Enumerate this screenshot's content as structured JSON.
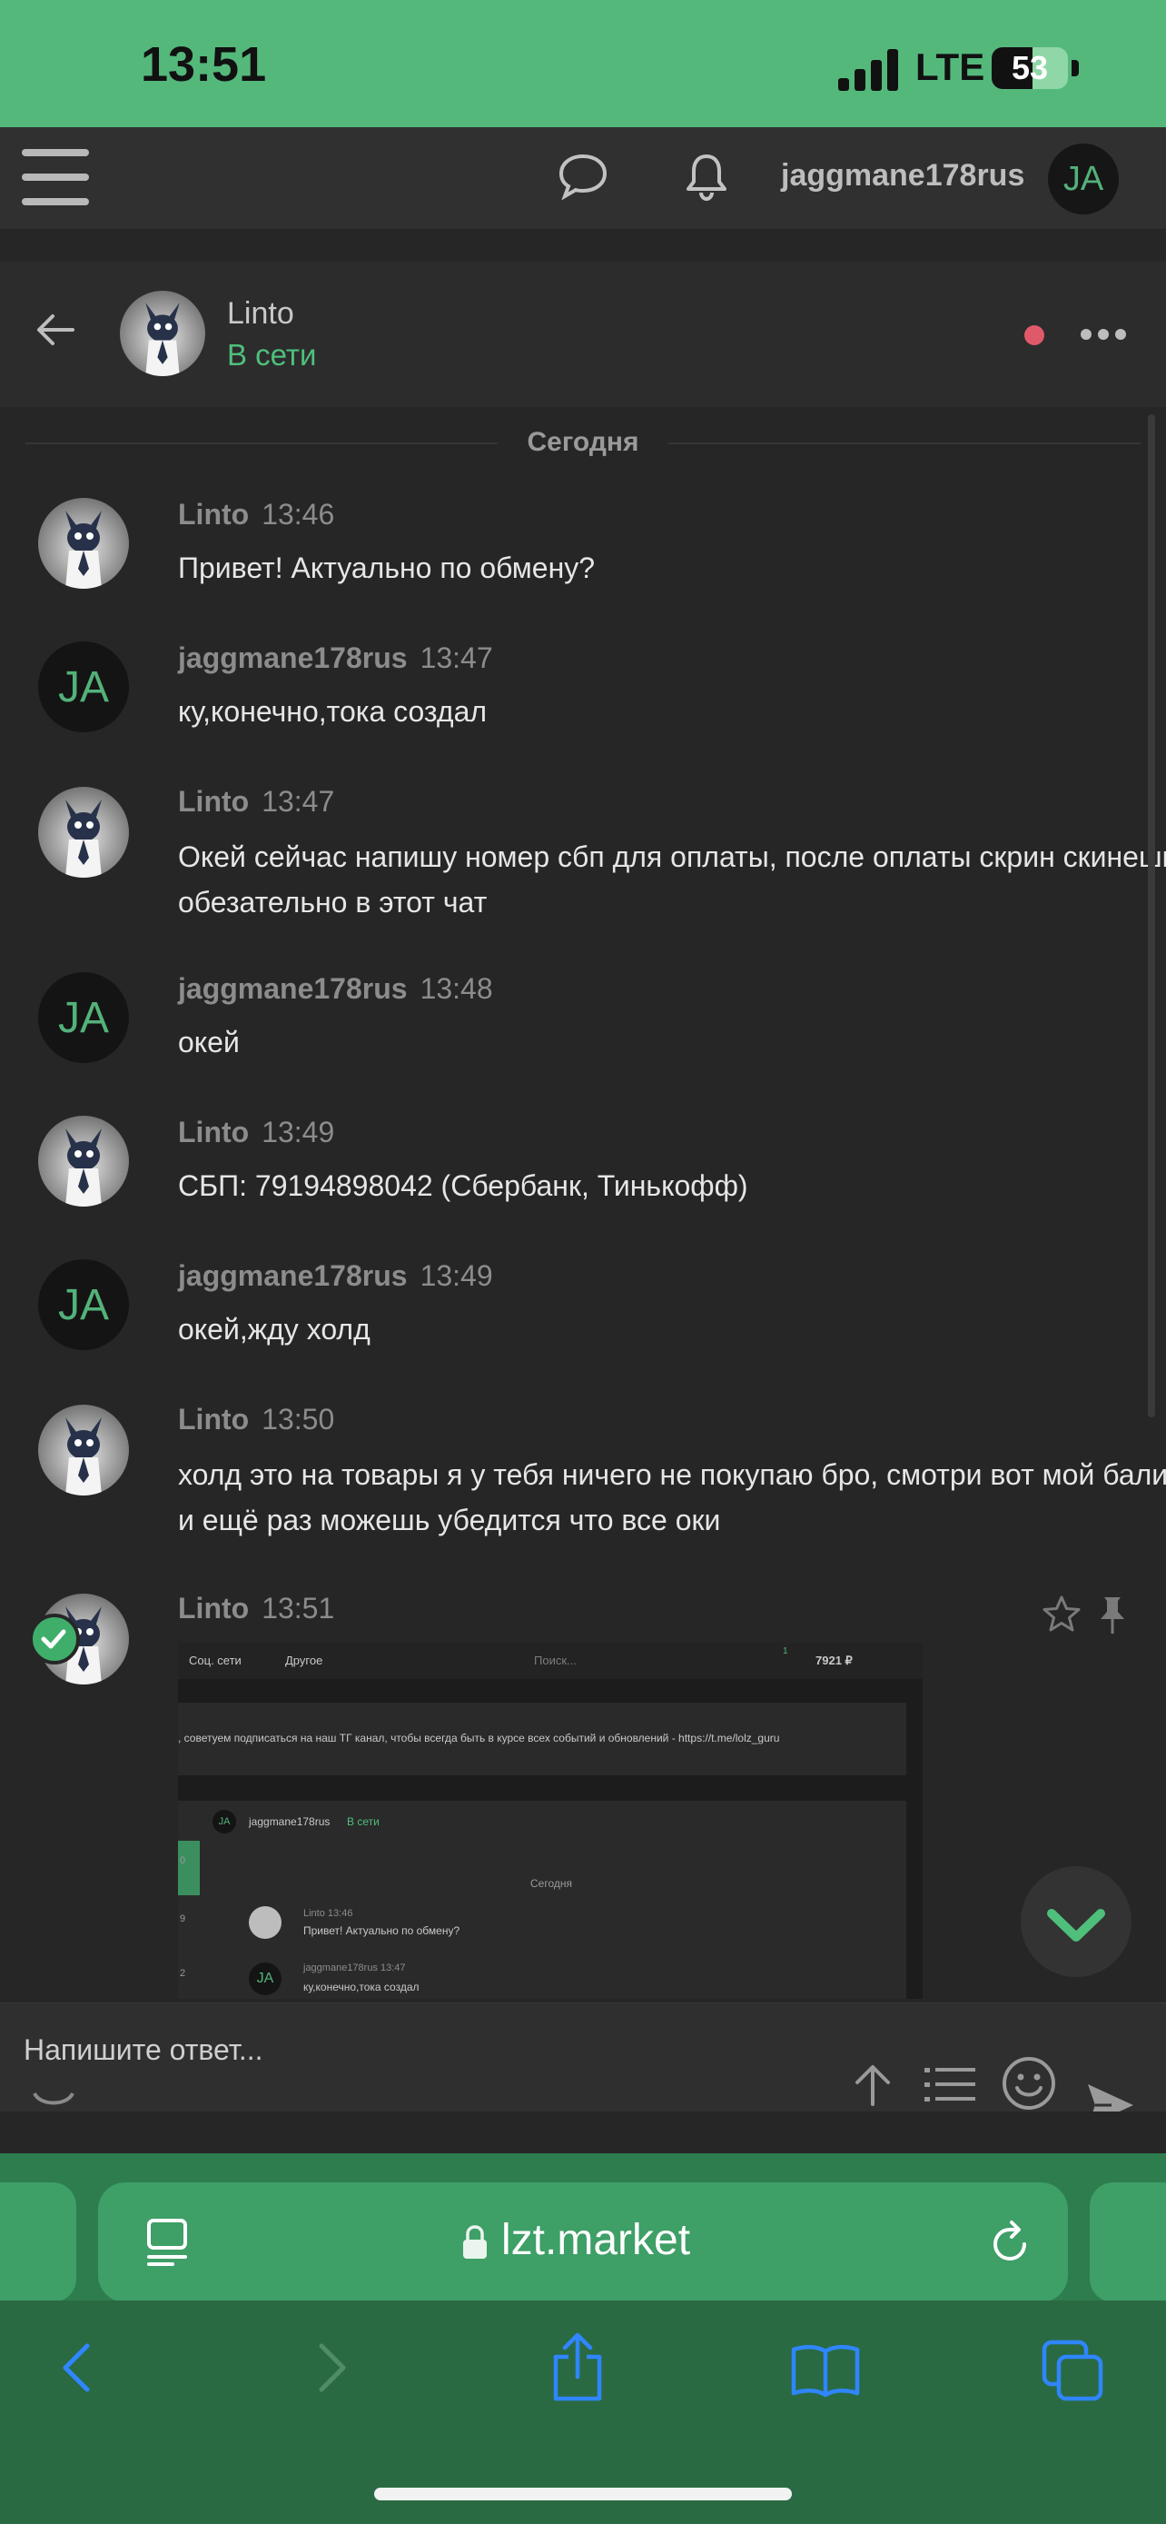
{
  "status_bar": {
    "time": "13:51",
    "network": "LTE",
    "battery": "53",
    "battery_level": 0.53
  },
  "header": {
    "username": "jaggmane178rus",
    "avatar_initials": "JA"
  },
  "conversation": {
    "name": "Linto",
    "status": "В сети",
    "date_divider": "Сегодня"
  },
  "messages": [
    {
      "author": "Linto",
      "time": "13:46",
      "text": "Привет! Актуально по обмену?"
    },
    {
      "author": "jaggmane178rus",
      "time": "13:47",
      "text": "ку,конечно,тока создал"
    },
    {
      "author": "Linto",
      "time": "13:47",
      "text": "Окей сейчас напишу номер сбп для оплаты, после оплаты скрин скинешь обезательно в этот чат"
    },
    {
      "author": "jaggmane178rus",
      "time": "13:48",
      "text": "окей"
    },
    {
      "author": "Linto",
      "time": "13:49",
      "text": "СБП: 79194898042 (Сбербанк, Тинькофф)"
    },
    {
      "author": "jaggmane178rus",
      "time": "13:49",
      "text": "окей,жду холд"
    },
    {
      "author": "Linto",
      "time": "13:50",
      "text": "холд это на товары я у тебя ничего не покупаю бро, смотри вот мой балик и ещё раз можешь убедится что все оки"
    },
    {
      "author": "Linto",
      "time": "13:51",
      "text": ""
    }
  ],
  "attachment": {
    "nav_social": "Соц. сети",
    "nav_other": "Другое",
    "search_placeholder": "Поиск...",
    "notif_count": "1",
    "balance": "7921 ₽",
    "banner_text": ", советуем подписаться на наш ТГ канал, чтобы всегда быть в курсе всех событий и обновлений - https://t.me/lolz_guru",
    "conv_user": "jaggmane178rus",
    "conv_status": "В сети",
    "date": "Сегодня",
    "m1_author": "Linto",
    "m1_time": "13:46",
    "m1_text": "Привет! Актуально по обмену?",
    "m2_author": "jaggmane178rus",
    "m2_time": "13:47",
    "m2_text": "ку,конечно,тока создал",
    "avatar_initials": "JA",
    "side_a": "0",
    "side_b": "9",
    "side_c": "2"
  },
  "reply": {
    "placeholder": "Напишите ответ..."
  },
  "browser": {
    "url": "lzt.market"
  },
  "icons": {
    "menu": "hamburger-menu-icon",
    "chat": "chat-bubble-icon",
    "bell": "bell-icon",
    "back": "back-arrow-icon",
    "more": "more-dots-icon",
    "star": "star-icon",
    "pin": "pin-icon",
    "upload": "upload-arrow-icon",
    "list": "list-icon",
    "smile": "smile-icon",
    "send": "send-icon",
    "reader": "reader-icon",
    "lock": "lock-icon",
    "reload": "reload-icon",
    "nav_back": "browser-back-icon",
    "nav_forward": "browser-forward-icon",
    "share": "share-icon",
    "bookmarks": "bookmarks-icon",
    "tabs": "tabs-icon"
  },
  "colors": {
    "accent_green": "#4fbf7c",
    "status_bar": "#54b87b",
    "online_dot": "#e0596a",
    "ios_blue": "#2f86ff"
  }
}
